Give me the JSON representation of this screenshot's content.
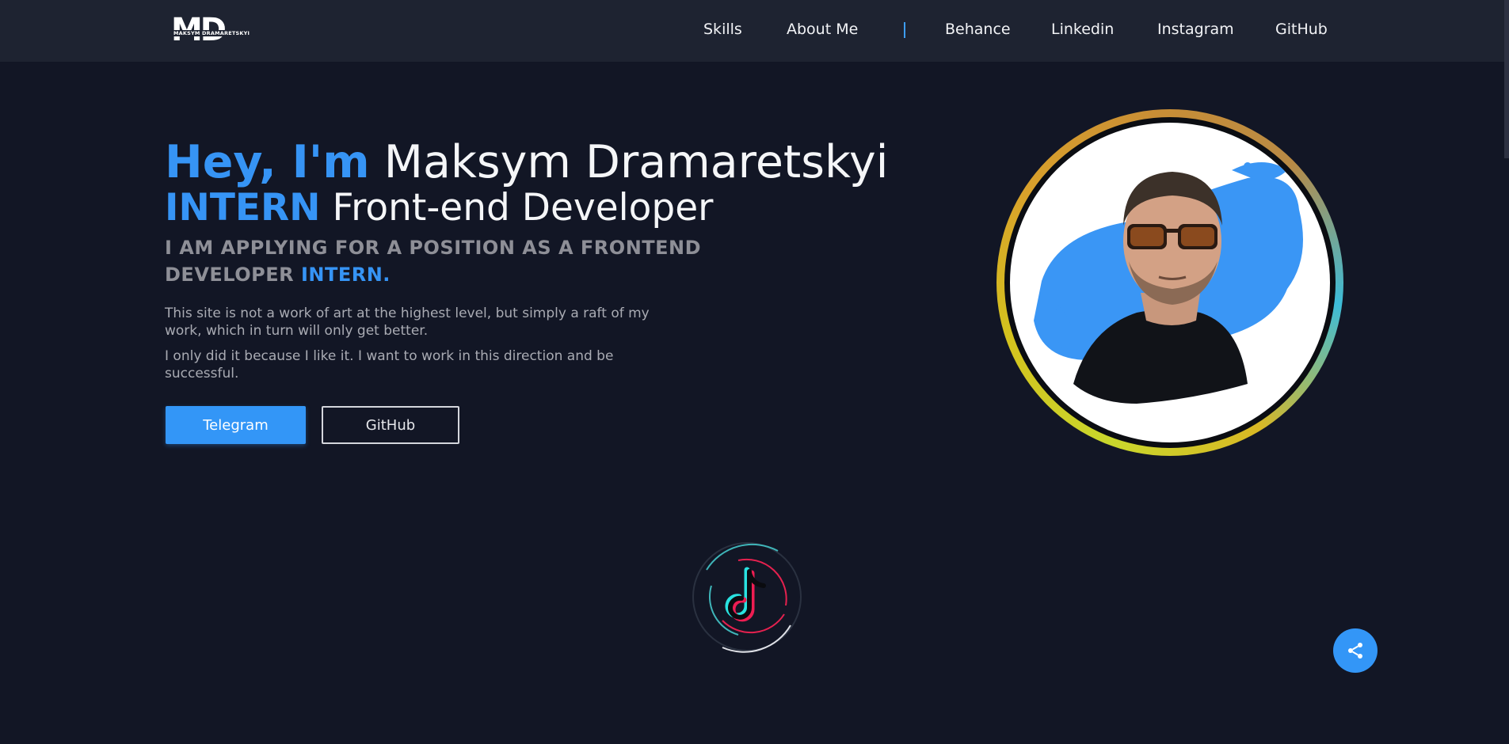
{
  "logo": {
    "letters": "MD",
    "name": "MAKSYM DRAMARETSKYI"
  },
  "nav": {
    "items": [
      "Skills",
      "About Me",
      "Behance",
      "Linkedin",
      "Instagram",
      "GitHub"
    ]
  },
  "hero": {
    "greeting": "Hey, I'm",
    "name": "Maksym Dramaretskyi",
    "role_accent": "INTERN",
    "role": "Front-end Developer",
    "subtitle": "I AM APPLYING FOR A POSITION AS A FRONTEND DEVELOPER",
    "subtitle_accent": "INTERN.",
    "paragraph1": "This site is not a work of art at the highest level, but simply a raft of my work, which in turn will only get better.",
    "paragraph2": "I only did it because I like it. I want to work in this direction and be successful."
  },
  "buttons": {
    "telegram": "Telegram",
    "github": "GitHub"
  },
  "icons": {
    "tiktok": "tiktok-icon",
    "share": "share-icon"
  },
  "colors": {
    "accent": "#3694f5",
    "background": "#121625",
    "header": "#1e2331"
  }
}
